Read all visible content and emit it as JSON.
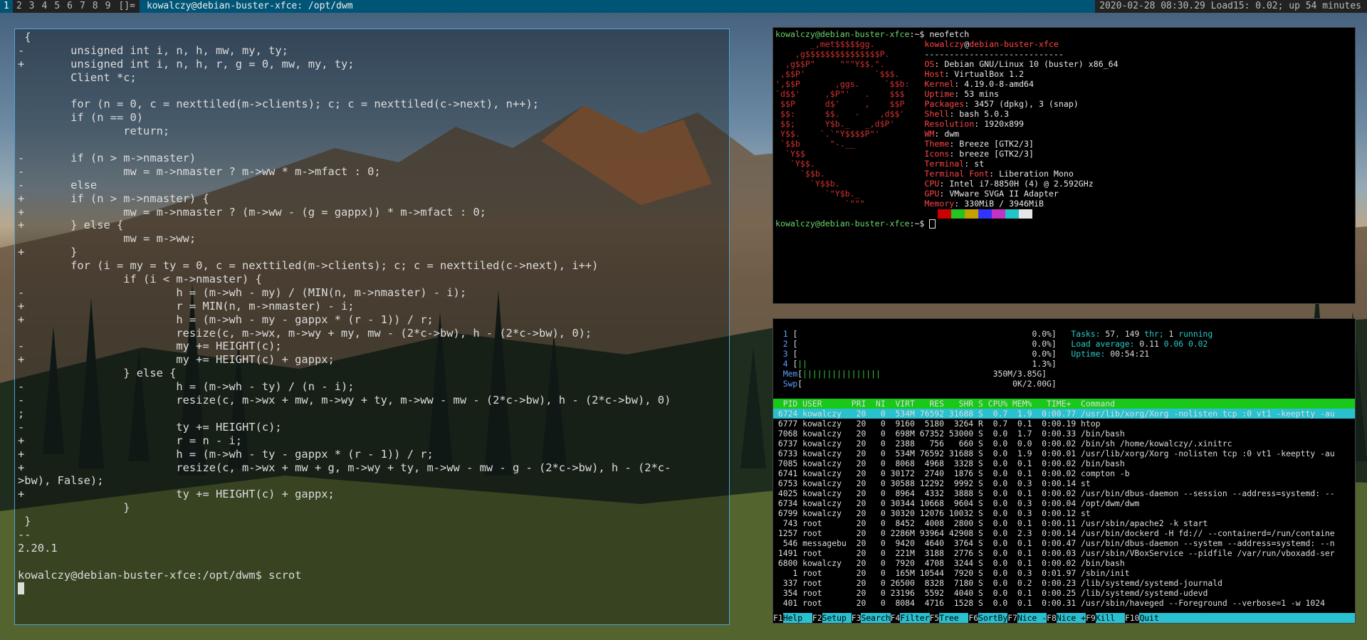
{
  "topbar": {
    "tags": [
      "1",
      "2",
      "3",
      "4",
      "5",
      "6",
      "7",
      "8",
      "9"
    ],
    "selected_tag": "1",
    "layout_symbol": "[]=",
    "window_title": "kowalczy@debian-buster-xfce: /opt/dwm",
    "status": "2020-02-28 08:30.29 Load15: 0.02; up 54 minutes"
  },
  "editor": {
    "lines": [
      " {",
      "-       unsigned int i, n, h, mw, my, ty;",
      "+       unsigned int i, n, h, r, g = 0, mw, my, ty;",
      "        Client *c;",
      "",
      "        for (n = 0, c = nexttiled(m->clients); c; c = nexttiled(c->next), n++);",
      "        if (n == 0)",
      "                return;",
      "",
      "-       if (n > m->nmaster)",
      "-               mw = m->nmaster ? m->ww * m->mfact : 0;",
      "-       else",
      "+       if (n > m->nmaster) {",
      "+               mw = m->nmaster ? (m->ww - (g = gappx)) * m->mfact : 0;",
      "+       } else {",
      "                mw = m->ww;",
      "+       }",
      "        for (i = my = ty = 0, c = nexttiled(m->clients); c; c = nexttiled(c->next), i++)",
      "                if (i < m->nmaster) {",
      "-                       h = (m->wh - my) / (MIN(n, m->nmaster) - i);",
      "+                       r = MIN(n, m->nmaster) - i;",
      "+                       h = (m->wh - my - gappx * (r - 1)) / r;",
      "                        resize(c, m->wx, m->wy + my, mw - (2*c->bw), h - (2*c->bw), 0);",
      "-                       my += HEIGHT(c);",
      "+                       my += HEIGHT(c) + gappx;",
      "                } else {",
      "-                       h = (m->wh - ty) / (n - i);",
      "-                       resize(c, m->wx + mw, m->wy + ty, m->ww - mw - (2*c->bw), h - (2*c->bw), 0)",
      ";",
      "-                       ty += HEIGHT(c);",
      "+                       r = n - i;",
      "+                       h = (m->wh - ty - gappx * (r - 1)) / r;",
      "+                       resize(c, m->wx + mw + g, m->wy + ty, m->ww - mw - g - (2*c->bw), h - (2*c-",
      ">bw), False);",
      "+                       ty += HEIGHT(c) + gappx;",
      "                }",
      " }",
      "--",
      "2.20.1",
      ""
    ],
    "prompt_user": "kowalczy@debian-buster-xfce",
    "prompt_path": ":/opt/dwm$",
    "prompt_cmd": " scrot"
  },
  "neofetch": {
    "prompt1_user": "kowalczy@debian-buster-xfce",
    "prompt1_rest": ":~$ neofetch",
    "logo": [
      "       _,met$$$$$gg.",
      "    ,g$$$$$$$$$$$$$$$P.",
      "  ,g$$P\"     \"\"\"Y$$.\".",
      " ,$$P'              `$$$.",
      "',$$P       ,ggs.     `$$b:",
      "`d$$'     ,$P\"'   .    $$$",
      " $$P      d$'     ,    $$P",
      " $$:      $$.   -    ,d$$'",
      " $$;      Y$b._   _,d$P'",
      " Y$$.    `.`\"Y$$$$P\"'",
      " `$$b      \"-.__",
      "  `Y$$",
      "   `Y$$.",
      "     `$$b.",
      "       `Y$$b.",
      "          `\"Y$b._",
      "              `\"\"\""
    ],
    "user": "kowalczy",
    "host": "debian-buster-xfce",
    "separator": "----------------------------",
    "info": [
      {
        "key": "OS",
        "val": "Debian GNU/Linux 10 (buster) x86_64"
      },
      {
        "key": "Host",
        "val": "VirtualBox 1.2"
      },
      {
        "key": "Kernel",
        "val": "4.19.0-8-amd64"
      },
      {
        "key": "Uptime",
        "val": "53 mins"
      },
      {
        "key": "Packages",
        "val": "3457 (dpkg), 3 (snap)"
      },
      {
        "key": "Shell",
        "val": "bash 5.0.3"
      },
      {
        "key": "Resolution",
        "val": "1920x899"
      },
      {
        "key": "WM",
        "val": "dwm"
      },
      {
        "key": "Theme",
        "val": "Breeze [GTK2/3]"
      },
      {
        "key": "Icons",
        "val": "breeze [GTK2/3]"
      },
      {
        "key": "Terminal",
        "val": "st"
      },
      {
        "key": "Terminal Font",
        "val": "Liberation Mono"
      },
      {
        "key": "CPU",
        "val": "Intel i7-8850H (4) @ 2.592GHz"
      },
      {
        "key": "GPU",
        "val": "VMware SVGA II Adapter"
      },
      {
        "key": "Memory",
        "val": "330MiB / 3946MiB"
      }
    ],
    "palette": [
      "#000000",
      "#cc0000",
      "#22c522",
      "#c4a000",
      "#3333ff",
      "#c533c5",
      "#22c5c5",
      "#e5e5e5"
    ],
    "prompt2_user": "kowalczy@debian-buster-xfce",
    "prompt2_rest": ":~$ "
  },
  "htop": {
    "cpus": [
      {
        "n": "1",
        "bar": "",
        "pct": "0.0%]"
      },
      {
        "n": "2",
        "bar": "",
        "pct": "0.0%]"
      },
      {
        "n": "3",
        "bar": "",
        "pct": "0.0%]"
      },
      {
        "n": "4",
        "bar": "||",
        "pct": "1.3%]"
      }
    ],
    "mem": {
      "label": "Mem",
      "bar": "||||||||||||||||",
      "val": "350M/3.85G]"
    },
    "swp": {
      "label": "Swp",
      "bar": "",
      "val": "0K/2.00G]"
    },
    "tasks_label": "Tasks: ",
    "tasks": "57",
    "thr": "149",
    "thr_label": " thr; ",
    "running": "1",
    "running_label": " running",
    "load_label": "Load average: ",
    "load1": "0.11",
    "load5": "0.06",
    "load15": "0.02",
    "uptime_label": "Uptime: ",
    "uptime": "00:54:21",
    "header": "  PID USER      PRI  NI  VIRT   RES   SHR S CPU% MEM%   TIME+  Command",
    "rows": [
      " 6724 kowalczy   20   0  534M 76592 31688 S  0.7  1.9  0:00.77 /usr/lib/xorg/Xorg -nolisten tcp :0 vt1 -keeptty -au",
      " 6777 kowalczy   20   0  9160  5180  3264 R  0.7  0.1  0:00.19 htop",
      " 7068 kowalczy   20   0  698M 67352 53000 S  0.0  1.7  0:00.33 /bin/bash",
      " 6737 kowalczy   20   0  2388   756   660 S  0.0  0.0  0:00.02 /bin/sh /home/kowalczy/.xinitrc",
      " 6733 kowalczy   20   0  534M 76592 31688 S  0.0  1.9  0:00.01 /usr/lib/xorg/Xorg -nolisten tcp :0 vt1 -keeptty -au",
      " 7085 kowalczy   20   0  8068  4968  3328 S  0.0  0.1  0:00.02 /bin/bash",
      " 6741 kowalczy   20   0 30172  2740  1876 S  0.0  0.1  0:00.02 compton -b",
      " 6753 kowalczy   20   0 30588 12292  9992 S  0.0  0.3  0:00.14 st",
      " 4025 kowalczy   20   0  8964  4332  3888 S  0.0  0.1  0:00.02 /usr/bin/dbus-daemon --session --address=systemd: --",
      " 6734 kowalczy   20   0 30344 10668  9604 S  0.0  0.3  0:00.04 /opt/dwm/dwm",
      " 6799 kowalczy   20   0 30320 12076 10032 S  0.0  0.3  0:00.12 st",
      "  743 root       20   0  8452  4008  2800 S  0.0  0.1  0:00.11 /usr/sbin/apache2 -k start",
      " 1257 root       20   0 2286M 93964 42908 S  0.0  2.3  0:00.14 /usr/bin/dockerd -H fd:// --containerd=/run/containe",
      "  546 messagebu  20   0  9420  4640  3764 S  0.0  0.1  0:00.47 /usr/bin/dbus-daemon --system --address=systemd: --n",
      " 1491 root       20   0  221M  3188  2776 S  0.0  0.1  0:00.03 /usr/sbin/VBoxService --pidfile /var/run/vboxadd-ser",
      " 6800 kowalczy   20   0  7920  4708  3244 S  0.0  0.1  0:00.02 /bin/bash",
      "    1 root       20   0  165M 10544  7920 S  0.0  0.3  0:01.97 /sbin/init",
      "  337 root       20   0 26500  8328  7180 S  0.0  0.2  0:00.23 /lib/systemd/systemd-journald",
      "  354 root       20   0 23196  5592  4040 S  0.0  0.1  0:00.25 /lib/systemd/systemd-udevd",
      "  401 root       20   0  8084  4716  1528 S  0.0  0.1  0:00.31 /usr/sbin/haveged --Foreground --verbose=1 -w 1024"
    ],
    "fkeys": [
      {
        "k": "F1",
        "l": "Help  "
      },
      {
        "k": "F2",
        "l": "Setup "
      },
      {
        "k": "F3",
        "l": "Search"
      },
      {
        "k": "F4",
        "l": "Filter"
      },
      {
        "k": "F5",
        "l": "Tree  "
      },
      {
        "k": "F6",
        "l": "SortBy"
      },
      {
        "k": "F7",
        "l": "Nice -"
      },
      {
        "k": "F8",
        "l": "Nice +"
      },
      {
        "k": "F9",
        "l": "Kill  "
      },
      {
        "k": "F10",
        "l": "Quit"
      }
    ]
  }
}
